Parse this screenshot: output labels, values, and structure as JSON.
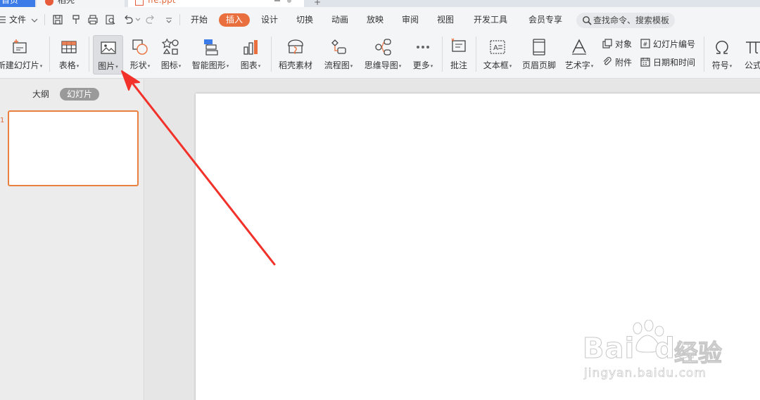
{
  "tabstrip": {
    "home_label": "首页",
    "daoke_label": "稻壳",
    "file_label": "ffe.ppt",
    "plus": "+"
  },
  "menubar": {
    "file_menu": "文件",
    "tabs": [
      "开始",
      "插入",
      "设计",
      "切换",
      "动画",
      "放映",
      "审阅",
      "视图",
      "开发工具",
      "会员专享"
    ],
    "active_tab": "插入",
    "search_placeholder": "查找命令、搜索模板"
  },
  "ribbon": {
    "new_slide": "新建幻灯片",
    "table": "表格",
    "picture": "图片",
    "shape": "形状",
    "icon": "图标",
    "smartart": "智能图形",
    "chart": "图表",
    "daoke_material": "稻壳素材",
    "flowchart": "流程图",
    "mindmap": "思维导图",
    "more": "更多",
    "comment": "批注",
    "textbox": "文本框",
    "header_footer": "页眉页脚",
    "wordart": "艺术字",
    "object": "对象",
    "attachment": "附件",
    "slide_number": "幻灯片编号",
    "date_time": "日期和时间",
    "symbol": "符号",
    "formula": "公式"
  },
  "leftpanel": {
    "outline_tab": "大纲",
    "slides_tab": "幻灯片",
    "slide_number": "1"
  },
  "watermark": {
    "brand": "Bai",
    "brand2": "du",
    "cn": "经验",
    "url": "jingyan.baidu.com"
  },
  "colors": {
    "accent": "#e9703e",
    "annotation_arrow": "#f2322a",
    "thumb_border": "#e9803f"
  }
}
